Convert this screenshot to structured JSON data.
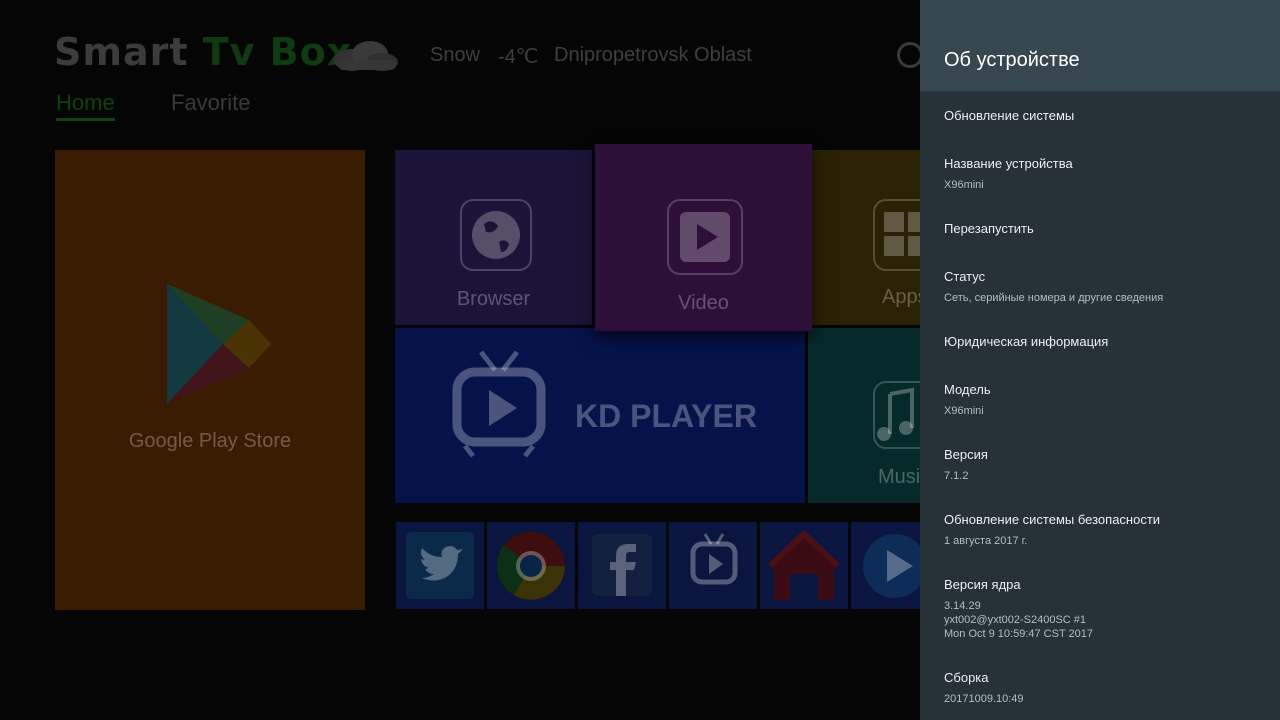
{
  "launcher": {
    "brand_part1": "Smart ",
    "brand_part2": "Tv Box",
    "weather": {
      "condition": "Snow",
      "temperature": "-4℃",
      "location": "Dnipropetrovsk Oblast"
    },
    "tabs": [
      {
        "label": "Home",
        "active": true
      },
      {
        "label": "Favorite",
        "active": false
      }
    ],
    "tiles": {
      "play_store": {
        "label": "Google Play Store",
        "color": "#3a1c03"
      },
      "browser": {
        "label": "Browser",
        "color": "#1c1438"
      },
      "video": {
        "label": "Video",
        "color": "#2e0f38"
      },
      "apps": {
        "label": "Apps",
        "color": "#2b2206"
      },
      "kd_player": {
        "label": "KD PLAYER",
        "color": "#06134b"
      },
      "music": {
        "label": "Music",
        "color": "#062a2a"
      }
    },
    "small_tiles": [
      {
        "name": "twitter",
        "icon": "twitter-icon"
      },
      {
        "name": "chrome",
        "icon": "chrome-icon"
      },
      {
        "name": "facebook",
        "icon": "facebook-icon"
      },
      {
        "name": "tv-player",
        "icon": "tv-player-icon"
      },
      {
        "name": "home-app",
        "icon": "house-icon"
      },
      {
        "name": "player",
        "icon": "play-circle-icon"
      }
    ]
  },
  "panel": {
    "title": "Об устройстве",
    "items": [
      {
        "title": "Обновление системы",
        "subtitle": ""
      },
      {
        "title": "Название устройства",
        "subtitle": "X96mini"
      },
      {
        "title": "Перезапустить",
        "subtitle": ""
      },
      {
        "title": "Статус",
        "subtitle": "Сеть, серийные номера и другие сведения"
      },
      {
        "title": "Юридическая информация",
        "subtitle": ""
      },
      {
        "title": "Модель",
        "subtitle": "X96mini"
      },
      {
        "title": "Версия",
        "subtitle": "7.1.2"
      },
      {
        "title": "Обновление системы безопасности",
        "subtitle": "1 августа 2017 г."
      },
      {
        "title": "Версия ядра",
        "subtitle": "3.14.29\nyxt002@yxt002-S2400SC #1\nMon Oct 9 10:59:47 CST 2017"
      },
      {
        "title": "Сборка",
        "subtitle": "20171009.10:49"
      }
    ]
  }
}
